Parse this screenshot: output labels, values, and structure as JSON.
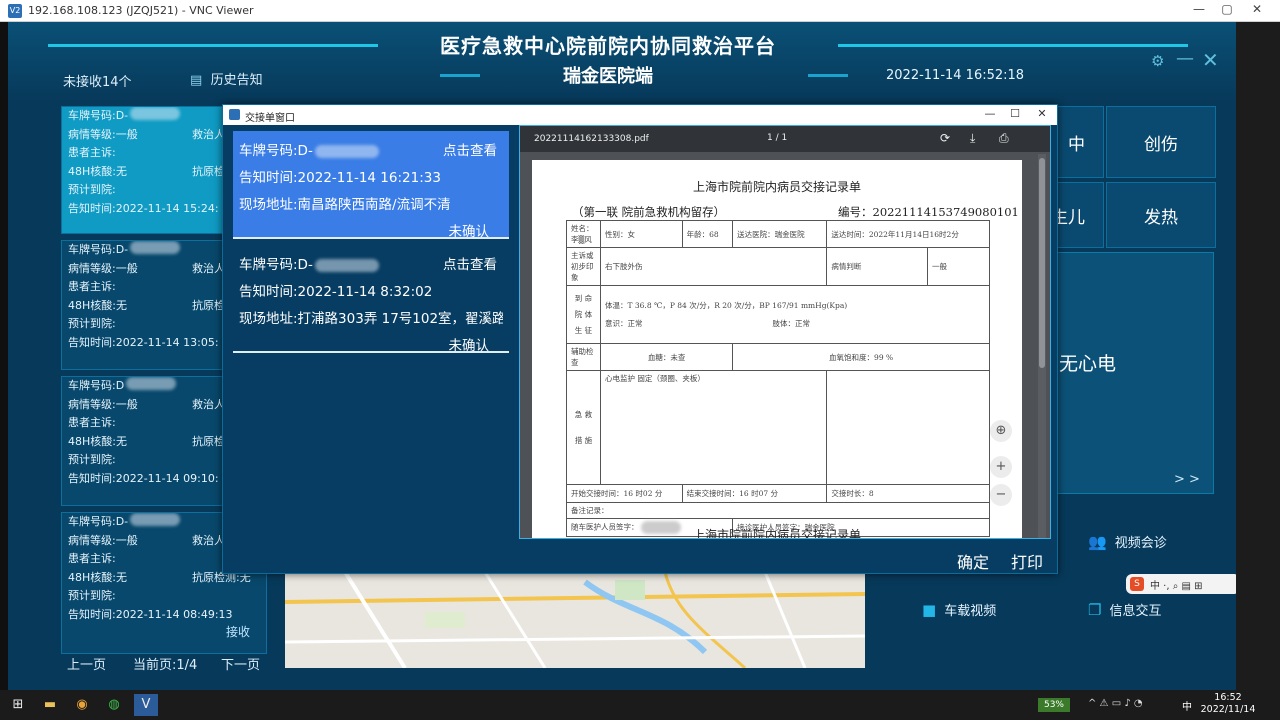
{
  "vnc": {
    "title": "192.168.108.123 (JZQJ521) - VNC Viewer",
    "logo": "V2"
  },
  "header": {
    "title": "医疗急救中心院前院内协同救治平台",
    "subtitle": "瑞金医院端",
    "datetime": "2022-11-14  16:52:18",
    "unreceived": "未接收14个",
    "history": "历史告知"
  },
  "cards": [
    {
      "plate": "车牌号码:D-",
      "level": "病情等级:一般",
      "treat": "救治人",
      "complaint": "患者主诉:",
      "nat": "48H核酸:无",
      "antigen": "抗原检",
      "eta": "预计到院:",
      "notified": "告知时间:2022-11-14 15:24:"
    },
    {
      "plate": "车牌号码:D-",
      "level": "病情等级:一般",
      "treat": "救治人",
      "complaint": "患者主诉:",
      "nat": "48H核酸:无",
      "antigen": "抗原检",
      "eta": "预计到院:",
      "notified": "告知时间:2022-11-14 13:05:"
    },
    {
      "plate": "车牌号码:D",
      "level": "病情等级:一般",
      "treat": "救治人",
      "complaint": "患者主诉:",
      "nat": "48H核酸:无",
      "antigen": "抗原检",
      "eta": "预计到院:",
      "notified": "告知时间:2022-11-14 09:10:"
    },
    {
      "plate": "车牌号码:D-",
      "level": "病情等级:一般",
      "treat": "救治人",
      "complaint": "患者主诉:",
      "nat": "48H核酸:无",
      "antigen": "抗原检测:无",
      "eta": "预计到院:",
      "notified": "告知时间:2022-11-14 08:49:13"
    }
  ],
  "receive_label": "接收",
  "pager": {
    "prev": "上一页",
    "current": "当前页:1/4",
    "next": "下一页"
  },
  "right_tiles": {
    "t1": "中",
    "t2": "创伤",
    "t3": "生儿",
    "t4": "发热",
    "big": "无心电",
    "more": "> >"
  },
  "bottom_buttons": {
    "video_consult": "视频会诊",
    "vehicle_video": "车载视频",
    "info_exchange": "信息交互"
  },
  "ime": {
    "s": "S",
    "items": "中 ·, ⌕ ▤ ⊞"
  },
  "dialog": {
    "title": "交接单窗口",
    "notices": [
      {
        "plate": "车牌号码:D-",
        "view": "点击查看",
        "time": "告知时间:2022-11-14 16:21:33",
        "address": "现场地址:南昌路陕西南路/流调不清",
        "status": "未确认"
      },
      {
        "plate": "车牌号码:D-",
        "view": "点击查看",
        "time": "告知时间:2022-11-14 8:32:02",
        "address": "现场地址:打浦路303弄 17号102室，翟溪路纟",
        "status": "未确认"
      }
    ],
    "confirm": "确定",
    "print": "打印"
  },
  "pdf": {
    "filename": "20221114162133308.pdf",
    "pages": "1 / 1",
    "doc_title": "上海市院前院内病员交接记录单",
    "doc_sub": "（第一联   院前急救机构留存）",
    "doc_no": "编号：20221114153749080101",
    "r1": {
      "name": "姓名：李▒风",
      "sex": "性别：女",
      "age": "年龄：68",
      "hospital": "送达医院：瑞金医院",
      "arrive": "送达时间：2022年11月14日16时2分"
    },
    "r2": {
      "complaint_label": "主诉或初步印象",
      "complaint": "右下肢外伤",
      "severity_label": "病情判断",
      "severity": "一般"
    },
    "r3": {
      "label": "到 命 院 体 生 征",
      "vitals": "体温：T 36.8 ℃，P 84 次/分，R 20 次/分，BP 167/91 mmHg(Kpa)",
      "consciousness": "意识：正常",
      "limbs": "肢体：正常"
    },
    "r4": {
      "label": "辅助检查",
      "glucose": "血糖：未查",
      "spo2": "血氧饱和度：99 %"
    },
    "r5": {
      "label": "急 救 措 施",
      "items": "心电监护 固定（颈圈、夹板）"
    },
    "r6": {
      "start": "开始交接时间：16 时02 分",
      "end": "结束交接时间：16 时07 分",
      "duration": "交接时长：8"
    },
    "r7": {
      "notes": "备注记录："
    },
    "r8": {
      "escort": "随车医护人员签字：",
      "receiver": "接诊医护人员签字：瑞金医院"
    },
    "next_page": "上海市院前院内病员交接记录单"
  },
  "taskbar": {
    "battery": "53%",
    "time": "16:52",
    "date": "2022/11/14",
    "ime": "中"
  }
}
